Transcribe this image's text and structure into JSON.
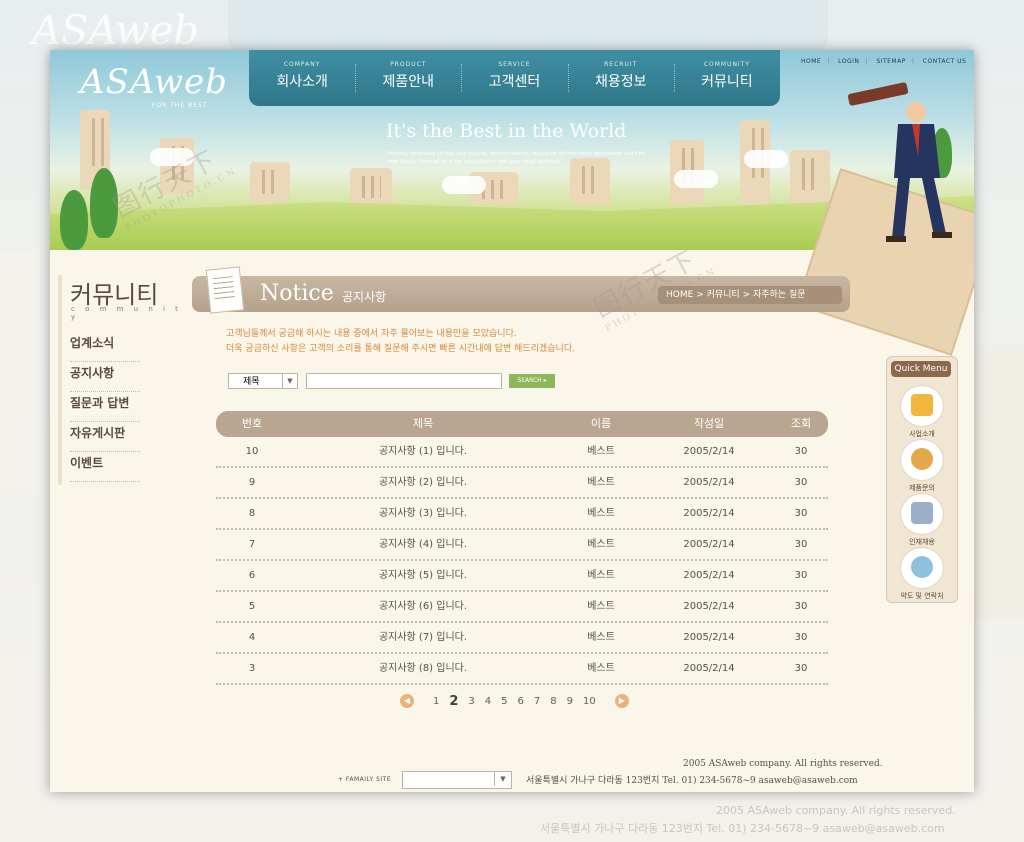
{
  "ghost": {
    "logo": "ASAweb",
    "footer_copy": "2005 ASAweb company. All rights reserved.",
    "footer_address": "서울특별시 가나구 다라동 123번지 Tel. 01) 234-5678~9  asaweb@asaweb.com"
  },
  "header": {
    "logo_main": "ASAweb",
    "logo_sub": "FOR THE BEST",
    "nav": [
      {
        "en": "COMPANY",
        "ko": "회사소개"
      },
      {
        "en": "PRODUCT",
        "ko": "제품안내"
      },
      {
        "en": "SERVICE",
        "ko": "고객센터"
      },
      {
        "en": "RECRUIT",
        "ko": "채용정보"
      },
      {
        "en": "COMMUNITY",
        "ko": "커뮤니티"
      }
    ],
    "util": [
      "HOME",
      "LOGIN",
      "SITEMAP",
      "CONTACT US"
    ],
    "hero_title": "It's the Best in the World",
    "hero_desc": "Hosting, dedicated ad-free web hosting, domain hosting, dedicated ad-free name registration and free web space. FortuneCity is the best place in host your small business..."
  },
  "sidebar": {
    "title": "커뮤니티",
    "subtitle": "c o m m u n i t y",
    "items": [
      "업계소식",
      "공지사항",
      "질문과 답변",
      "자유게시판",
      "이벤트"
    ]
  },
  "content": {
    "title_en": "Notice",
    "title_ko": "공지사항",
    "breadcrumb": [
      "HOME",
      "커뮤니티",
      "자주하는 질문"
    ],
    "intro_line1": "고객님들께서 궁금해 하시는 내용 중에서 자주 물어보는 내용만을 모았습니다.",
    "intro_line2": "더욱 궁금하신 사항은 고객의 소리를 통해 질문해 주시면 빠른 시간내에 답변 해드리겠습니다."
  },
  "search": {
    "select_value": "제목",
    "input_value": "",
    "button_label": "SEARCH ▸"
  },
  "table": {
    "headers": [
      "번호",
      "제목",
      "이름",
      "작성일",
      "조회"
    ],
    "rows": [
      [
        "10",
        "공지사항 (1) 입니다.",
        "베스트",
        "2005/2/14",
        "30"
      ],
      [
        "9",
        "공지사항 (2) 입니다.",
        "베스트",
        "2005/2/14",
        "30"
      ],
      [
        "8",
        "공지사항 (3) 입니다.",
        "베스트",
        "2005/2/14",
        "30"
      ],
      [
        "7",
        "공지사항 (4) 입니다.",
        "베스트",
        "2005/2/14",
        "30"
      ],
      [
        "6",
        "공지사항 (5) 입니다.",
        "베스트",
        "2005/2/14",
        "30"
      ],
      [
        "5",
        "공지사항 (6) 입니다.",
        "베스트",
        "2005/2/14",
        "30"
      ],
      [
        "4",
        "공지사항 (7) 입니다.",
        "베스트",
        "2005/2/14",
        "30"
      ],
      [
        "3",
        "공지사항 (8) 입니다.",
        "베스트",
        "2005/2/14",
        "30"
      ]
    ]
  },
  "paging": {
    "pages": [
      "1",
      "2",
      "3",
      "4",
      "5",
      "6",
      "7",
      "8",
      "9",
      "10"
    ],
    "current": "2",
    "prev_icon": "chevron-left-icon",
    "next_icon": "chevron-right-icon"
  },
  "quick_menu": {
    "title": "Quick Menu",
    "items": [
      "사업소개",
      "제품문의",
      "인재채용",
      "약도 및 연락처"
    ]
  },
  "footer": {
    "copyright": "2005 ASAweb company. All rights reserved.",
    "family_label": "+ FAMAILY SITE",
    "family_value": "",
    "address": "서울특별시 가나구 다라동 123번지 Tel. 01) 234-5678~9  asaweb@asaweb.com"
  },
  "watermark": {
    "text": "图行天下",
    "sub": "PHOTOPHOTO.CN"
  },
  "colors": {
    "nav_teal": "#2f7789",
    "table_header": "#b8a690",
    "accent_orange": "#d58a3a",
    "search_green": "#8eb65a"
  }
}
